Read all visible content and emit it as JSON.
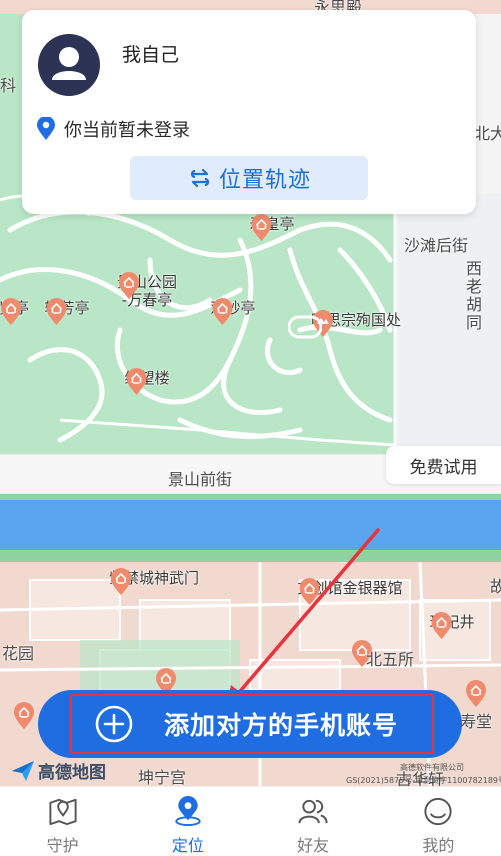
{
  "card": {
    "user_name": "我自己",
    "login_status": "你当前暂未登录",
    "track_button": "位置轨迹"
  },
  "map": {
    "pois": [
      {
        "id": "shouhuangting",
        "label": "寿皇亭"
      },
      {
        "id": "jishangongyuan",
        "label": "景山公园\n-万春亭"
      },
      {
        "id": "jifangting",
        "label": "辑芳亭"
      },
      {
        "id": "guanmiaoting",
        "label": "观妙亭"
      },
      {
        "id": "fulanting",
        "label": "览亭"
      },
      {
        "id": "mingsizong",
        "label": "明思宗殉国处"
      },
      {
        "id": "qiwanglou",
        "label": "绮望楼"
      },
      {
        "id": "zijincheng",
        "label": "紫禁城神武门"
      },
      {
        "id": "wenchuangguan",
        "label": "文创馆金银器馆"
      },
      {
        "id": "zhenfeijing",
        "label": "珍妃井"
      },
      {
        "id": "beiwusuo",
        "label": "北五所"
      },
      {
        "id": "huayuan",
        "label": "花园"
      },
      {
        "id": "kunninggong",
        "label": "坤宁宫"
      },
      {
        "id": "shoutang",
        "label": "寿堂"
      },
      {
        "id": "gujinxuan",
        "label": "古华轩"
      }
    ],
    "streets": {
      "jingshan_qianjie": "景山前街",
      "shatan_houjie": "沙滩后街",
      "xilao_hutong": "西老胡同",
      "kejian": "科",
      "beida": "北大",
      "yongsi": "永思殿",
      "gu": "故"
    },
    "free_trial": "免费试用",
    "amap_brand": "高德地图",
    "copyright_line1": "高德软件有限公司",
    "copyright_line2": "GS(2021)5875号-甲测资字1100782189号"
  },
  "add_button": {
    "label": "添加对方的手机账号"
  },
  "nav": {
    "items": [
      {
        "label": "守护",
        "icon": "guard-map-icon",
        "active": false
      },
      {
        "label": "定位",
        "icon": "location-icon",
        "active": true
      },
      {
        "label": "好友",
        "icon": "friends-icon",
        "active": false
      },
      {
        "label": "我的",
        "icon": "profile-icon",
        "active": false
      }
    ]
  },
  "colors": {
    "primary": "#1f6de0",
    "park_green": "#b9e6c7",
    "river_blue": "#5aa4f0",
    "palace_pink": "#f1d9d0",
    "poi_red": "#f08a6d",
    "annotation_red": "#e8323c"
  }
}
